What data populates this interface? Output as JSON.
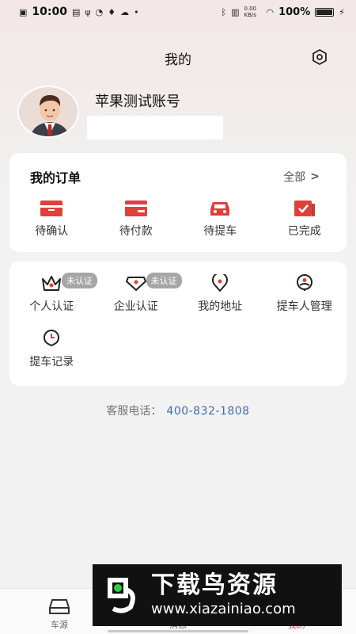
{
  "status_bar": {
    "time": "10:00",
    "network_speed": "0.00 KB/s",
    "battery": "100%"
  },
  "header": {
    "title": "我的"
  },
  "profile": {
    "name": "苹果测试账号"
  },
  "orders": {
    "title": "我的订单",
    "all_label": "全部",
    "items": [
      {
        "label": "待确认",
        "icon": "pending-confirm-icon"
      },
      {
        "label": "待付款",
        "icon": "pending-payment-icon"
      },
      {
        "label": "待提车",
        "icon": "pending-pickup-icon"
      },
      {
        "label": "已完成",
        "icon": "completed-icon"
      }
    ]
  },
  "services": {
    "items": [
      {
        "label": "个人认证",
        "badge": "未认证",
        "icon": "crown-icon"
      },
      {
        "label": "企业认证",
        "badge": "未认证",
        "icon": "diamond-icon"
      },
      {
        "label": "我的地址",
        "icon": "location-icon"
      },
      {
        "label": "提车人管理",
        "icon": "person-icon"
      },
      {
        "label": "提车记录",
        "icon": "clock-icon"
      }
    ]
  },
  "customer_service": {
    "label": "客服电话：",
    "phone": "400-832-1808"
  },
  "tabbar": {
    "items": [
      {
        "label": "车源",
        "icon": "car-icon",
        "active": false
      },
      {
        "label": "消息",
        "icon": "message-icon",
        "active": false
      },
      {
        "label": "我的",
        "icon": "user-icon",
        "active": true
      }
    ]
  },
  "watermark": {
    "title": "下载鸟资源",
    "url": "www.xiazainiao.com"
  },
  "colors": {
    "accent": "#e8453c",
    "phone": "#3d6fb0",
    "badge": "#a6a6a6"
  }
}
